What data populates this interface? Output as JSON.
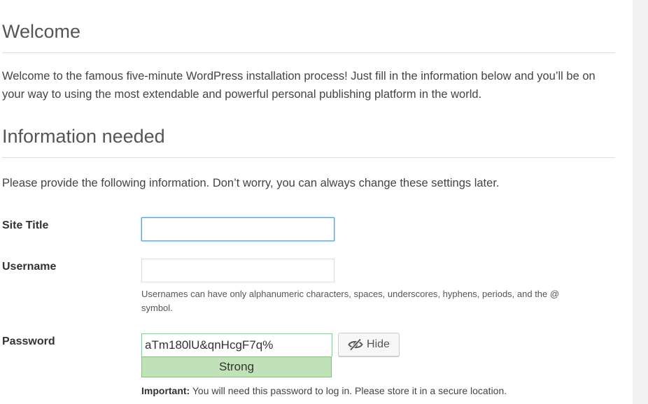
{
  "welcome": {
    "heading": "Welcome",
    "intro": "Welcome to the famous five-minute WordPress installation process! Just fill in the information below and you’ll be on your way to using the most extendable and powerful personal publishing platform in the world."
  },
  "info": {
    "heading": "Information needed",
    "description": "Please provide the following information. Don’t worry, you can always change these settings later."
  },
  "form": {
    "site_title": {
      "label": "Site Title",
      "value": ""
    },
    "username": {
      "label": "Username",
      "value": "",
      "hint": "Usernames can have only alphanumeric characters, spaces, underscores, hyphens, periods, and the @ symbol."
    },
    "password": {
      "label": "Password",
      "value": "aTm180lU&qnHcgF7q%",
      "strength": "Strong",
      "strength_color": "#c1e1b9",
      "hide_label": "Hide",
      "hide_icon": "eye-slash-icon",
      "important_label": "Important:",
      "important_text": " You will need this password to log in. Please store it in a secure location."
    }
  }
}
